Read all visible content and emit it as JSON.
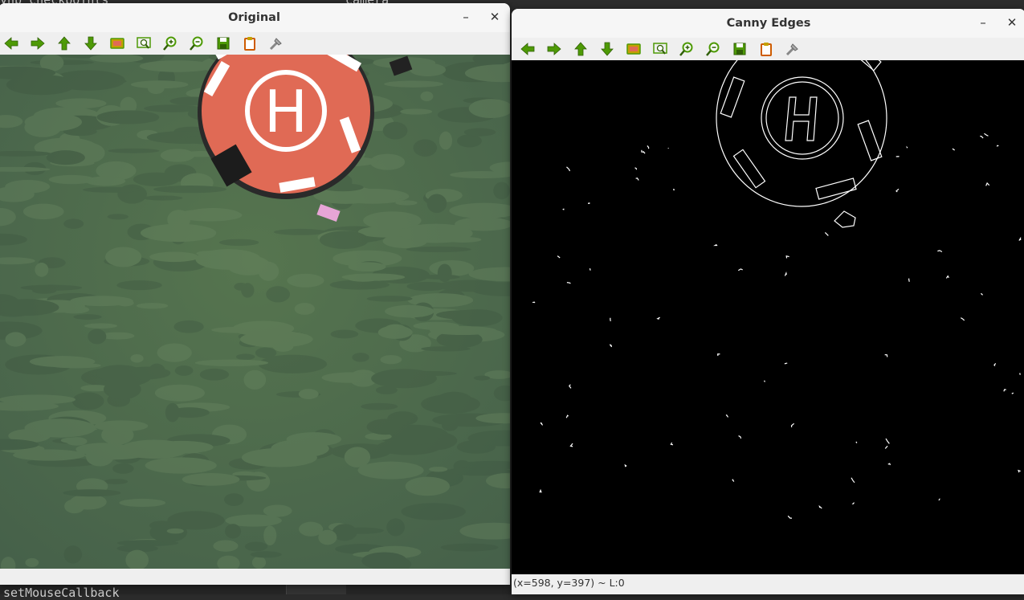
{
  "background": {
    "top_text": "ynb_checkpoints",
    "top_text_right": "camera",
    "bottom_text": "setMouseCallback"
  },
  "window_original": {
    "title": "Original",
    "minimize": "–",
    "close": "✕"
  },
  "window_canny": {
    "title": "Canny Edges",
    "minimize": "–",
    "close": "✕",
    "status": "(x=598, y=397) ~ L:0"
  },
  "toolbar_icons": [
    "arrow-left-icon",
    "arrow-right-icon",
    "arrow-up-icon",
    "arrow-down-icon",
    "zoom-fit-icon",
    "zoom-region-icon",
    "zoom-in-icon",
    "zoom-out-icon",
    "save-icon",
    "copy-icon",
    "properties-icon"
  ],
  "colors": {
    "icon_green": "#4e9a06",
    "icon_green_light": "#73d216",
    "helipad_red": "#e06a55",
    "grass": "#4f6c4d",
    "edge_white": "#ffffff"
  }
}
